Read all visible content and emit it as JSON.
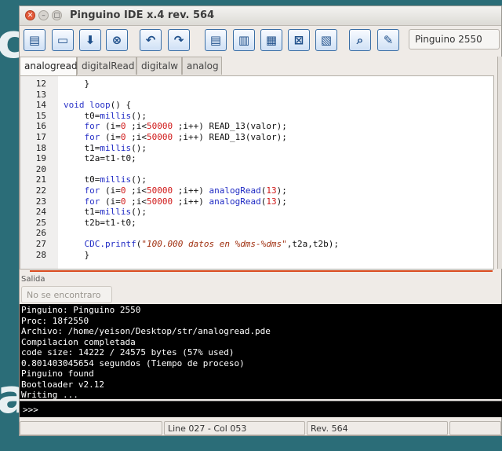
{
  "window": {
    "title": "Pinguino IDE x.4 rev. 564"
  },
  "toolbar": {
    "board_select": "Pinguino 2550",
    "buttons": [
      {
        "icon": "new-file-icon"
      },
      {
        "icon": "open-folder-icon"
      },
      {
        "icon": "save-icon"
      },
      {
        "icon": "close-file-icon"
      },
      {
        "icon": "undo-icon"
      },
      {
        "icon": "redo-icon"
      },
      {
        "icon": "cut-icon"
      },
      {
        "icon": "copy-icon"
      },
      {
        "icon": "paste-icon"
      },
      {
        "icon": "clear-icon"
      },
      {
        "icon": "select-all-icon"
      },
      {
        "icon": "search-icon"
      },
      {
        "icon": "replace-icon"
      }
    ]
  },
  "tabs": [
    "analogread",
    "digitalRead",
    "digitalw",
    "analog"
  ],
  "editor": {
    "line_numbers": [
      "12",
      "13",
      "14",
      "15",
      "16",
      "17",
      "18",
      "19",
      "20",
      "21",
      "22",
      "23",
      "24",
      "25",
      "26",
      "27",
      "28"
    ]
  },
  "output": {
    "title": "Salida",
    "filter_placeholder": "No se encontraro",
    "lines": [
      "Pinguino: Pinguino 2550",
      "Proc: 18f2550",
      "Archivo: /home/yeison/Desktop/str/analogread.pde",
      "Compilacion completada",
      "code size: 14222 / 24575 bytes (57% used)",
      "0.801403045654 segundos (Tiempo de proceso)",
      "Pinguino found",
      "Bootloader v2.12",
      "Writing ..."
    ],
    "prompt": ">>>"
  },
  "status": {
    "position": "Line 027 - Col 053",
    "revision": "Rev. 564"
  },
  "colors": {
    "keyword": "#2a33c8",
    "number": "#d01818",
    "string": "#a03010",
    "accent": "#d94b1f"
  }
}
